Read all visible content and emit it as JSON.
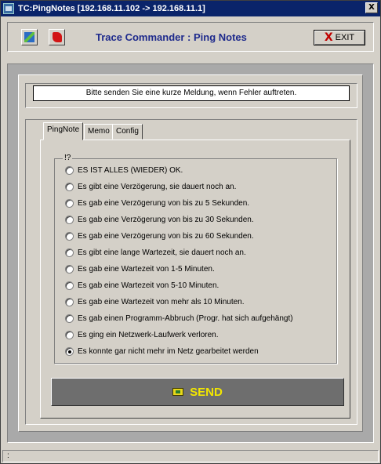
{
  "window": {
    "title": "TC:PingNotes [192.168.11.102 -> 192.168.11.1]",
    "close_label": "X"
  },
  "header": {
    "title": "Trace Commander : Ping Notes",
    "exit_icon": "X",
    "exit_label": "EXIT"
  },
  "message_box": {
    "text": "Bitte senden Sie eine kurze Meldung, wenn Fehler auftreten."
  },
  "tabs": [
    {
      "label": "PingNote",
      "active": true
    },
    {
      "label": "Memo",
      "active": false
    },
    {
      "label": "Config",
      "active": false
    }
  ],
  "group": {
    "title": "!?",
    "options": [
      {
        "label": "ES IST ALLES (WIEDER) OK.",
        "checked": false
      },
      {
        "label": "Es gibt eine Verzögerung, sie dauert noch an.",
        "checked": false
      },
      {
        "label": "Es gab eine Verzögerung von bis zu 5 Sekunden.",
        "checked": false
      },
      {
        "label": "Es gab eine Verzögerung von bis zu 30 Sekunden.",
        "checked": false
      },
      {
        "label": "Es gab eine Verzögerung von bis zu 60 Sekunden.",
        "checked": false
      },
      {
        "label": "Es gibt eine lange Wartezeit, sie dauert noch an.",
        "checked": false
      },
      {
        "label": "Es gab eine Wartezeit von 1-5 Minuten.",
        "checked": false
      },
      {
        "label": "Es gab eine Wartezeit von 5-10 Minuten.",
        "checked": false
      },
      {
        "label": "Es gab eine Wartezeit von mehr als 10 Minuten.",
        "checked": false
      },
      {
        "label": "Es gab einen Programm-Abbruch (Progr. hat sich aufgehängt)",
        "checked": false
      },
      {
        "label": "Es ging ein Netzwerk-Laufwerk verloren.",
        "checked": false
      },
      {
        "label": "Es konnte gar nicht mehr im Netz gearbeitet werden",
        "checked": true
      }
    ]
  },
  "send": {
    "label": "SEND",
    "icon": "send-icon"
  },
  "statusbar": {
    "text": ":"
  },
  "colors": {
    "titlebar": "#0a246a",
    "header_title": "#1e2a8c",
    "send_bg": "#6e6e6e",
    "send_text": "#f2e600"
  }
}
